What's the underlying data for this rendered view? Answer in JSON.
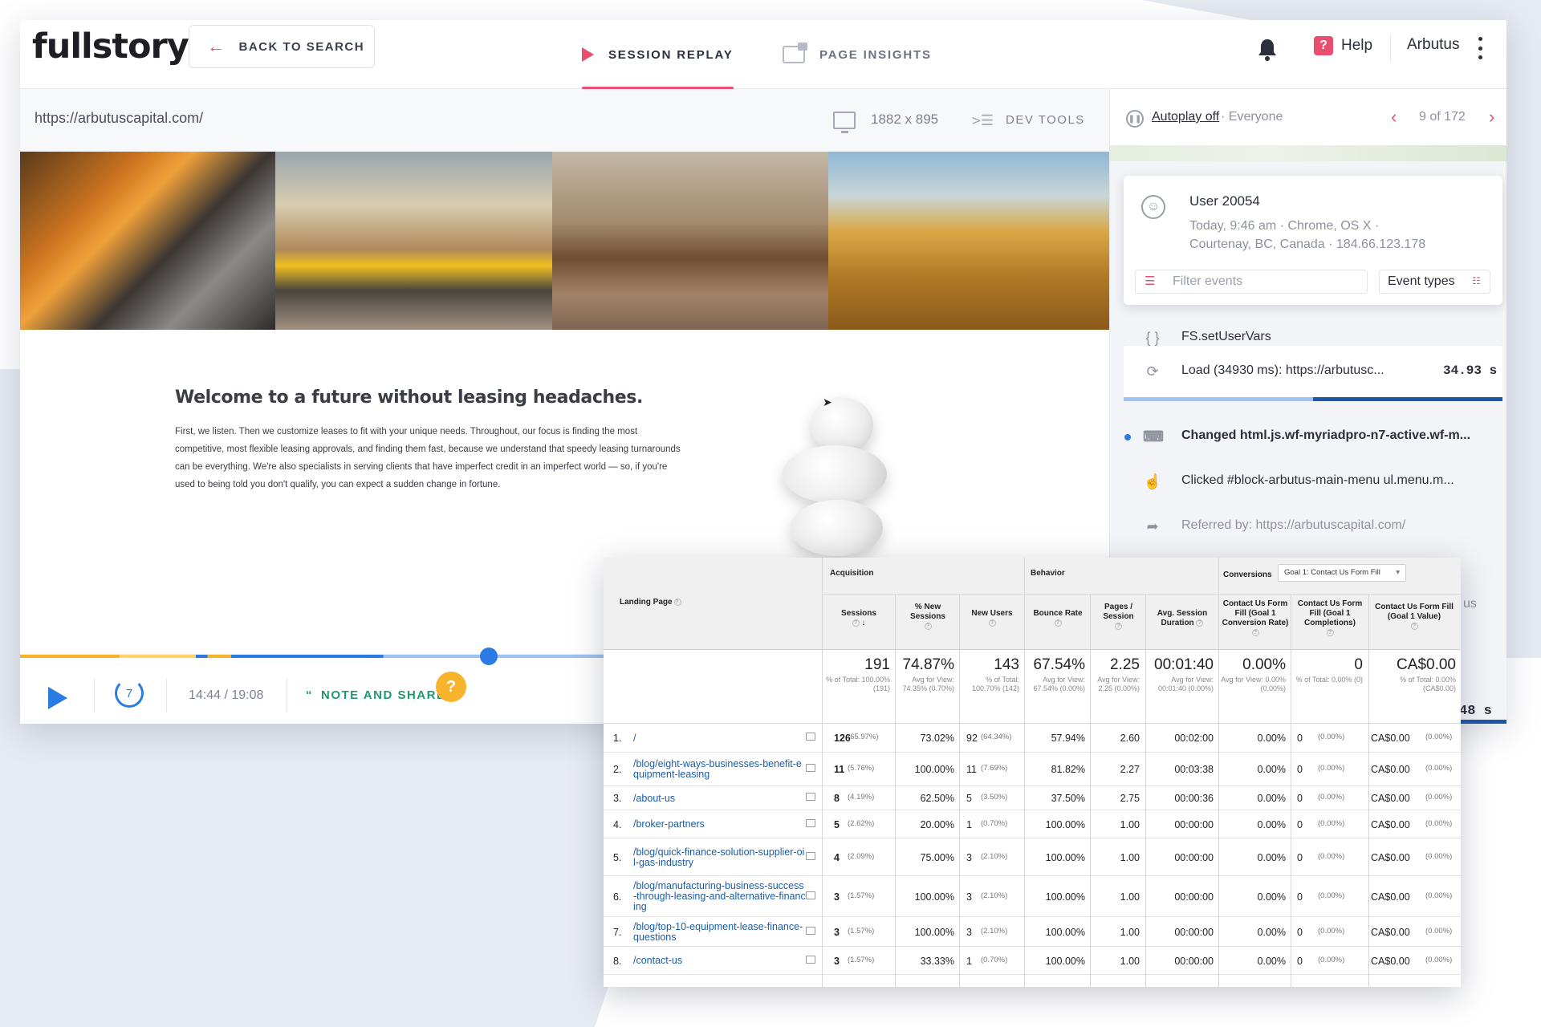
{
  "brand": {
    "logo": "fullstory",
    "accent": "#e94d6f",
    "blue": "#2c7be5"
  },
  "topbar": {
    "back_label": "BACK TO SEARCH",
    "tabs": [
      {
        "label": "SESSION REPLAY",
        "active": true
      },
      {
        "label": "PAGE INSIGHTS",
        "active": false
      }
    ],
    "help_label": "Help",
    "help_icon": "?",
    "account": "Arbutus"
  },
  "player": {
    "url": "https://arbutuscapital.com/",
    "viewport": "1882 x 895",
    "devtools_label": "DEV TOOLS",
    "content_title": "Welcome to a future without leasing headaches.",
    "content_body": "First, we listen. Then we customize leases to fit with your unique needs. Throughout, our focus is finding the most competitive, most flexible leasing approvals, and finding them fast, because we understand that speedy leasing turnarounds can be everything. We're also specialists in serving clients that have imperfect credit in an imperfect world — so, if you're used to being told you don't qualify, you can expect a sudden change in fortune.",
    "rewind_seconds": "7",
    "time": "14:44 / 19:08",
    "note_icon": "“",
    "note_label": "NOTE AND SHARE",
    "help_bubble": "?",
    "progress_fraction": 0.8
  },
  "sidebar": {
    "autoplay": "Autoplay off",
    "audience": "· Everyone",
    "counter": "9 of 172",
    "user": {
      "name": "User 20054",
      "line1": "Today, 9:46 am  ·  Chrome, OS X  ·",
      "line2": "Courtenay, BC, Canada  ·  184.66.123.178"
    },
    "filter_placeholder": "Filter events",
    "event_types_label": "Event types",
    "events": [
      {
        "icon": "{ }",
        "text": "FS.setUserVars"
      },
      {
        "icon": "⟳",
        "text": "Load (34930 ms): https://arbutusc...",
        "duration": "34.93  s"
      },
      {
        "icon": "⌨",
        "text": "Changed html.js.wf-myriadpro-n7-active.wf-m..."
      },
      {
        "icon": "☝",
        "text": "Clicked #block-arbutus-main-menu ul.menu.m..."
      },
      {
        "icon": "➦",
        "text": "Referred by: https://arbutuscapital.com/"
      }
    ],
    "partial_us": "us",
    "partial_duration": "48  s"
  },
  "analytics": {
    "groups": {
      "acquisition": "Acquisition",
      "behavior": "Behavior",
      "conversions": "Conversions"
    },
    "goal_select": "Goal 1: Contact Us Form Fill",
    "columns": {
      "landing_page": "Landing Page",
      "sessions": "Sessions",
      "new_sessions": "% New Sessions",
      "new_users": "New Users",
      "bounce_rate": "Bounce Rate",
      "pages_session": "Pages / Session",
      "avg_duration": "Avg. Session Duration",
      "conv_rate": "Contact Us Form Fill (Goal 1 Conversion Rate)",
      "completions": "Contact Us Form Fill (Goal 1 Completions)",
      "value": "Contact Us Form Fill (Goal 1 Value)"
    },
    "totals": [
      {
        "value": "191",
        "note": "% of Total: 100.00% (191)"
      },
      {
        "value": "74.87%",
        "note": "Avg for View: 74.35% (0.70%)"
      },
      {
        "value": "143",
        "note": "% of Total: 100.70% (142)"
      },
      {
        "value": "67.54%",
        "note": "Avg for View: 67.54% (0.00%)"
      },
      {
        "value": "2.25",
        "note": "Avg for View: 2.25 (0.00%)"
      },
      {
        "value": "00:01:40",
        "note": "Avg for View: 00:01:40 (0.00%)"
      },
      {
        "value": "0.00%",
        "note": "Avg for View: 0.00% (0.00%)"
      },
      {
        "value": "0",
        "note": "% of Total: 0.00% (0)"
      },
      {
        "value": "CA$0.00",
        "note": "% of Total: 0.00% (CA$0.00)"
      }
    ],
    "rows": [
      {
        "rank": "1.",
        "page": "/",
        "sessions": "126",
        "sessions_pct": "(65.97%)",
        "new_sessions": "73.02%",
        "new_users": "92",
        "new_users_pct": "(64.34%)",
        "bounce": "57.94%",
        "pages": "2.60",
        "duration": "00:02:00",
        "conv_rate": "0.00%",
        "completions": "0",
        "completions_pct": "(0.00%)",
        "value": "CA$0.00",
        "value_pct": "(0.00%)"
      },
      {
        "rank": "2.",
        "page": "/blog/eight-ways-businesses-benefit-equipment-leasing",
        "sessions": "11",
        "sessions_pct": "(5.76%)",
        "new_sessions": "100.00%",
        "new_users": "11",
        "new_users_pct": "(7.69%)",
        "bounce": "81.82%",
        "pages": "2.27",
        "duration": "00:03:38",
        "conv_rate": "0.00%",
        "completions": "0",
        "completions_pct": "(0.00%)",
        "value": "CA$0.00",
        "value_pct": "(0.00%)"
      },
      {
        "rank": "3.",
        "page": "/about-us",
        "sessions": "8",
        "sessions_pct": "(4.19%)",
        "new_sessions": "62.50%",
        "new_users": "5",
        "new_users_pct": "(3.50%)",
        "bounce": "37.50%",
        "pages": "2.75",
        "duration": "00:00:36",
        "conv_rate": "0.00%",
        "completions": "0",
        "completions_pct": "(0.00%)",
        "value": "CA$0.00",
        "value_pct": "(0.00%)"
      },
      {
        "rank": "4.",
        "page": "/broker-partners",
        "sessions": "5",
        "sessions_pct": "(2.62%)",
        "new_sessions": "20.00%",
        "new_users": "1",
        "new_users_pct": "(0.70%)",
        "bounce": "100.00%",
        "pages": "1.00",
        "duration": "00:00:00",
        "conv_rate": "0.00%",
        "completions": "0",
        "completions_pct": "(0.00%)",
        "value": "CA$0.00",
        "value_pct": "(0.00%)"
      },
      {
        "rank": "5.",
        "page": "/blog/quick-finance-solution-supplier-oil-gas-industry",
        "sessions": "4",
        "sessions_pct": "(2.09%)",
        "new_sessions": "75.00%",
        "new_users": "3",
        "new_users_pct": "(2.10%)",
        "bounce": "100.00%",
        "pages": "1.00",
        "duration": "00:00:00",
        "conv_rate": "0.00%",
        "completions": "0",
        "completions_pct": "(0.00%)",
        "value": "CA$0.00",
        "value_pct": "(0.00%)"
      },
      {
        "rank": "6.",
        "page": "/blog/manufacturing-business-success-through-leasing-and-alternative-financing",
        "sessions": "3",
        "sessions_pct": "(1.57%)",
        "new_sessions": "100.00%",
        "new_users": "3",
        "new_users_pct": "(2.10%)",
        "bounce": "100.00%",
        "pages": "1.00",
        "duration": "00:00:00",
        "conv_rate": "0.00%",
        "completions": "0",
        "completions_pct": "(0.00%)",
        "value": "CA$0.00",
        "value_pct": "(0.00%)"
      },
      {
        "rank": "7.",
        "page": "/blog/top-10-equipment-lease-finance-questions",
        "sessions": "3",
        "sessions_pct": "(1.57%)",
        "new_sessions": "100.00%",
        "new_users": "3",
        "new_users_pct": "(2.10%)",
        "bounce": "100.00%",
        "pages": "1.00",
        "duration": "00:00:00",
        "conv_rate": "0.00%",
        "completions": "0",
        "completions_pct": "(0.00%)",
        "value": "CA$0.00",
        "value_pct": "(0.00%)"
      },
      {
        "rank": "8.",
        "page": "/contact-us",
        "sessions": "3",
        "sessions_pct": "(1.57%)",
        "new_sessions": "33.33%",
        "new_users": "1",
        "new_users_pct": "(0.70%)",
        "bounce": "100.00%",
        "pages": "1.00",
        "duration": "00:00:00",
        "conv_rate": "0.00%",
        "completions": "0",
        "completions_pct": "(0.00%)",
        "value": "CA$0.00",
        "value_pct": "(0.00%)"
      }
    ]
  }
}
